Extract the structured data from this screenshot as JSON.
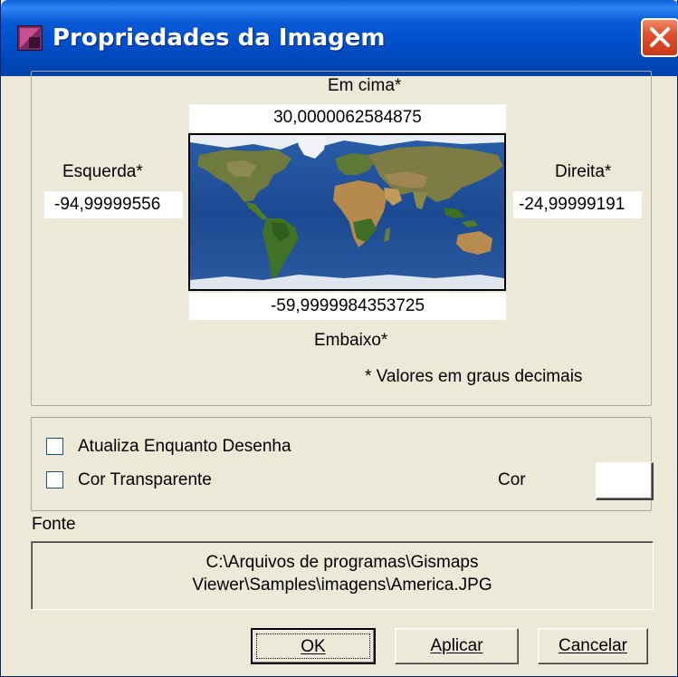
{
  "window": {
    "title": "Propriedades da Imagem",
    "icons": {
      "app": "image-app-icon",
      "close": "close-x-icon"
    },
    "colors": {
      "titlebar": "#0050cc",
      "close": "#e0502d",
      "face": "#ece9d8"
    }
  },
  "bounds": {
    "top_label": "Em cima*",
    "top_value": "30,0000062584875",
    "left_label": "Esquerda*",
    "left_value": "-94,99999556",
    "right_label": "Direita*",
    "right_value": "-24,99999191",
    "bottom_value": "-59,9999984353725",
    "bottom_label": "Embaixo*",
    "note": "* Valores em graus decimais",
    "preview_image": "world-map-preview"
  },
  "options": {
    "update_while_drawing": {
      "label": "Atualiza Enquanto Desenha",
      "checked": false
    },
    "transparent_color": {
      "label": "Cor Transparente",
      "checked": false
    },
    "color_label": "Cor",
    "color_value": "#ffffff"
  },
  "source": {
    "label": "Fonte",
    "path": "C:\\Arquivos de programas\\Gismaps\nViewer\\Samples\\imagens\\America.JPG"
  },
  "buttons": {
    "ok": "OK",
    "apply": "Aplicar",
    "cancel": "Cancelar"
  }
}
